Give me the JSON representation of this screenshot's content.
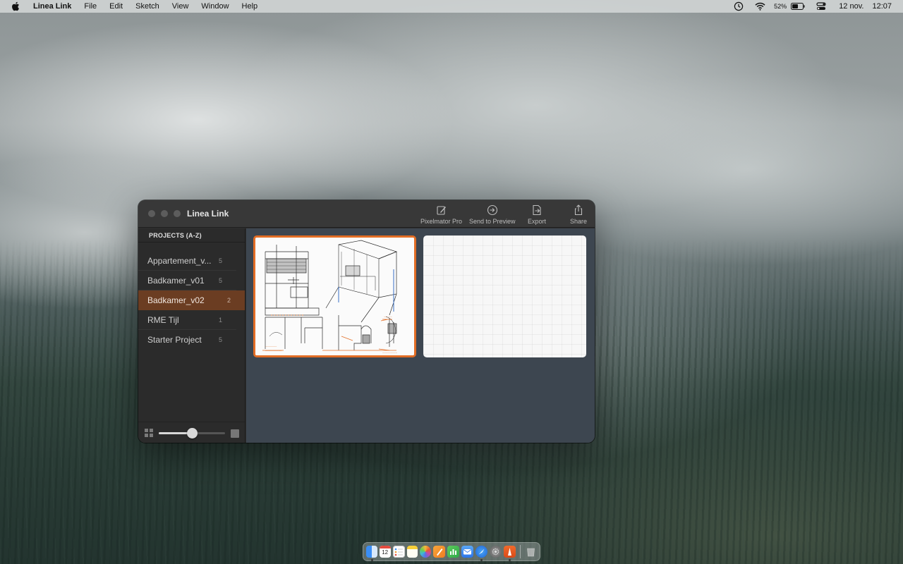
{
  "menubar": {
    "app_name": "Linea Link",
    "items": [
      "File",
      "Edit",
      "Sketch",
      "View",
      "Window",
      "Help"
    ],
    "battery": "52%",
    "date": "12 nov.",
    "time": "12:07"
  },
  "window": {
    "title": "Linea Link",
    "toolbar": {
      "pixelmator": "Pixelmator Pro",
      "send_preview": "Send to Preview",
      "export": "Export",
      "share": "Share"
    },
    "sidebar": {
      "header": "PROJECTS (A-Z)",
      "projects": [
        {
          "name": "Appartement_v...",
          "count": "5"
        },
        {
          "name": "Badkamer_v01",
          "count": "5"
        },
        {
          "name": "Badkamer_v02",
          "count": "2"
        },
        {
          "name": "RME Tijl",
          "count": "1"
        },
        {
          "name": "Starter Project",
          "count": "5"
        }
      ],
      "selected_index": 2,
      "thumbnail_size_slider": 0.5
    },
    "sketches": [
      {
        "selected": true,
        "kind": "drawing"
      },
      {
        "selected": false,
        "kind": "blank"
      }
    ]
  },
  "colors": {
    "accent": "#e26d25",
    "selected_row": "#6b3d22",
    "content_bg": "#3d4650"
  },
  "dock": {
    "icons": [
      "finder-icon",
      "calendar-icon",
      "reminders-icon",
      "notes-icon",
      "photos-icon",
      "pages-icon",
      "numbers-icon",
      "mail-icon",
      "safari-icon",
      "system-preferences-icon",
      "linea-link-icon",
      "trash-icon"
    ],
    "calendar_day": "12"
  }
}
